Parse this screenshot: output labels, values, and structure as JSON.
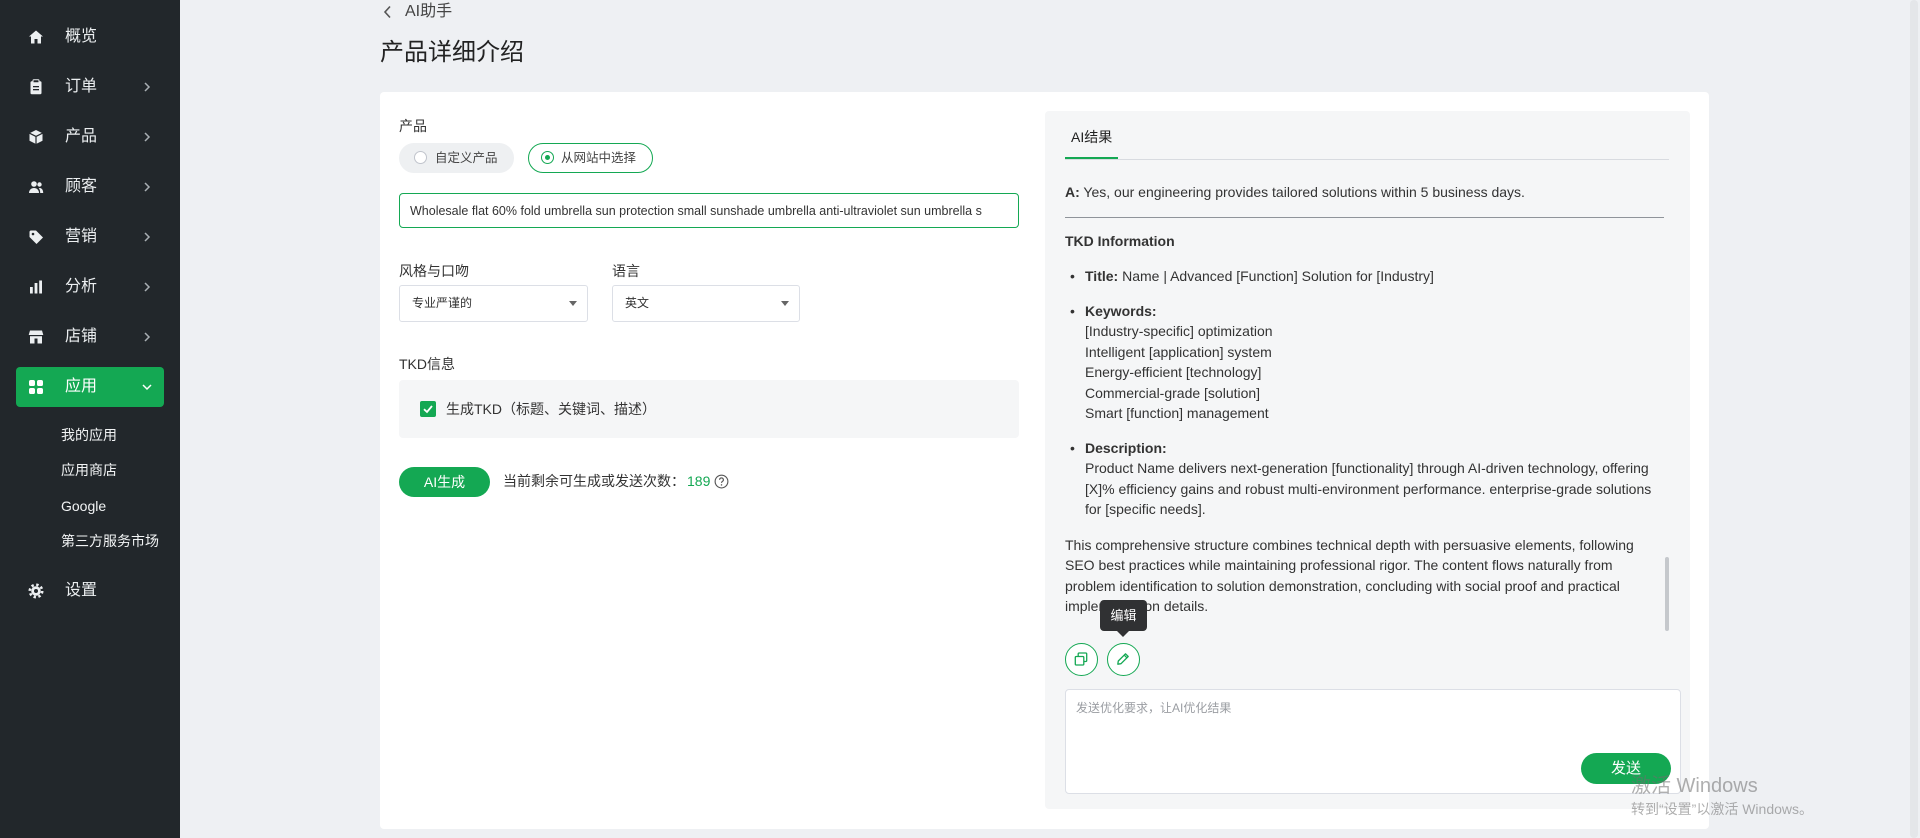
{
  "sidebar": {
    "items": [
      {
        "label": "概览",
        "icon": "home-icon",
        "expandable": false
      },
      {
        "label": "订单",
        "icon": "clipboard-icon",
        "expandable": true
      },
      {
        "label": "产品",
        "icon": "box-icon",
        "expandable": true
      },
      {
        "label": "顾客",
        "icon": "users-icon",
        "expandable": true
      },
      {
        "label": "营销",
        "icon": "tag-icon",
        "expandable": true
      },
      {
        "label": "分析",
        "icon": "bar-chart-icon",
        "expandable": true
      },
      {
        "label": "店铺",
        "icon": "store-icon",
        "expandable": true
      },
      {
        "label": "应用",
        "icon": "apps-grid-icon",
        "expandable": true,
        "active": true
      }
    ],
    "sub_items": [
      "我的应用",
      "应用商店",
      "Google",
      "第三方服务市场"
    ],
    "footer_item": {
      "label": "设置",
      "icon": "gear-icon"
    }
  },
  "header": {
    "back_label": "AI助手",
    "title": "产品详细介绍"
  },
  "form": {
    "product_label": "产品",
    "product_options": [
      {
        "label": "自定义产品",
        "selected": false
      },
      {
        "label": "从网站中选择",
        "selected": true
      }
    ],
    "product_value": "Wholesale flat 60% fold umbrella sun protection small sunshade umbrella anti-ultraviolet sun umbrella s",
    "style_label": "风格与口吻",
    "style_value": "专业严谨的",
    "language_label": "语言",
    "language_value": "英文",
    "tkd_label": "TKD信息",
    "tkd_checkbox_label": "生成TKD（标题、关键词、描述）",
    "tkd_checked": true,
    "generate_button": "AI生成",
    "remaining_label": "当前剩余可生成或发送次数：",
    "remaining_count": "189"
  },
  "result": {
    "tab": "AI结果",
    "answer_prefix": "A:",
    "answer_text": " Yes, our engineering provides tailored solutions within 5 business days.",
    "section_heading": "TKD Information",
    "title_label": "Title:",
    "title_text": " Name | Advanced [Function] Solution for [Industry]",
    "keywords_label": "Keywords:",
    "keywords": [
      "[Industry-specific] optimization",
      "Intelligent [application] system",
      "Energy-efficient [technology]",
      "Commercial-grade [solution]",
      "Smart [function] management"
    ],
    "description_label": "Description:",
    "description_text": "Product Name delivers next-generation [functionality] through AI-driven technology, offering [X]% efficiency gains and robust multi-environment performance. enterprise-grade solutions for [specific needs].",
    "summary": "This comprehensive structure combines technical depth with persuasive elements, following SEO best practices while maintaining professional rigor. The content flows naturally from problem identification to solution demonstration, concluding with social proof and practical implementation details.",
    "actions": {
      "copy_icon": "copy-icon",
      "edit_icon": "edit-icon",
      "edit_tooltip": "编辑"
    },
    "input_placeholder": "发送优化要求，让AI优化结果",
    "send_button": "发送"
  },
  "watermark": {
    "title": "激活 Windows",
    "subtitle": "转到“设置”以激活 Windows。"
  },
  "colors": {
    "primary": "#14a853",
    "sidebar_bg": "#22272b",
    "page_bg": "#eef0f3",
    "panel_bg": "#f5f6f7",
    "tooltip_bg": "#303133"
  }
}
